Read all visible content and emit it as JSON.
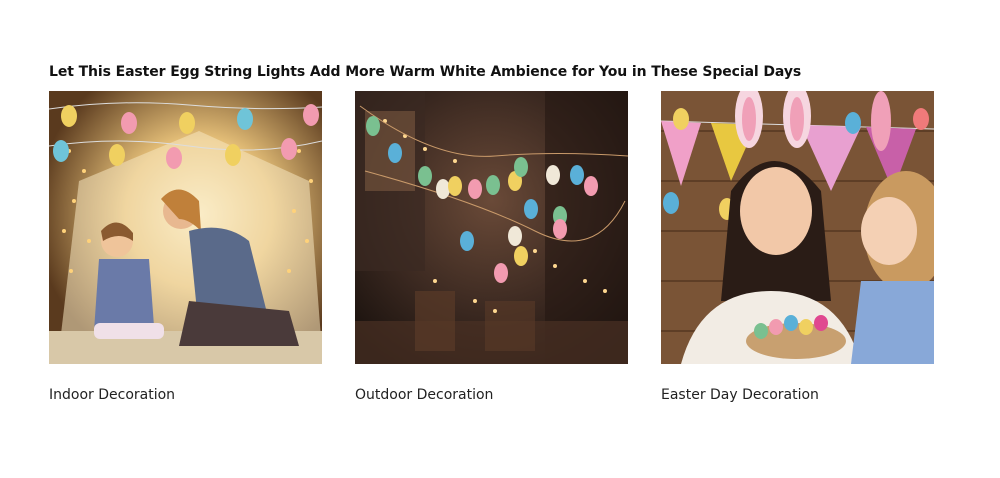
{
  "section": {
    "title": "Let This Easter Egg String Lights Add More Warm White Ambience for You in These Special Days"
  },
  "cards": [
    {
      "caption": "Indoor Decoration",
      "image": "mother-daughter-in-tent-with-easter-egg-lights",
      "colors": {
        "bg": "#6b4a2a",
        "glow": "#f4d48a"
      }
    },
    {
      "caption": "Outdoor Decoration",
      "image": "easter-egg-lights-on-balcony-at-night",
      "colors": {
        "bg": "#2a1e18",
        "glow": "#d99a4a"
      }
    },
    {
      "caption": "Easter Day Decoration",
      "image": "mother-daughter-bunny-ears-easter-basket",
      "colors": {
        "bg": "#7a5436",
        "glow": "#f2d6b8"
      }
    }
  ]
}
